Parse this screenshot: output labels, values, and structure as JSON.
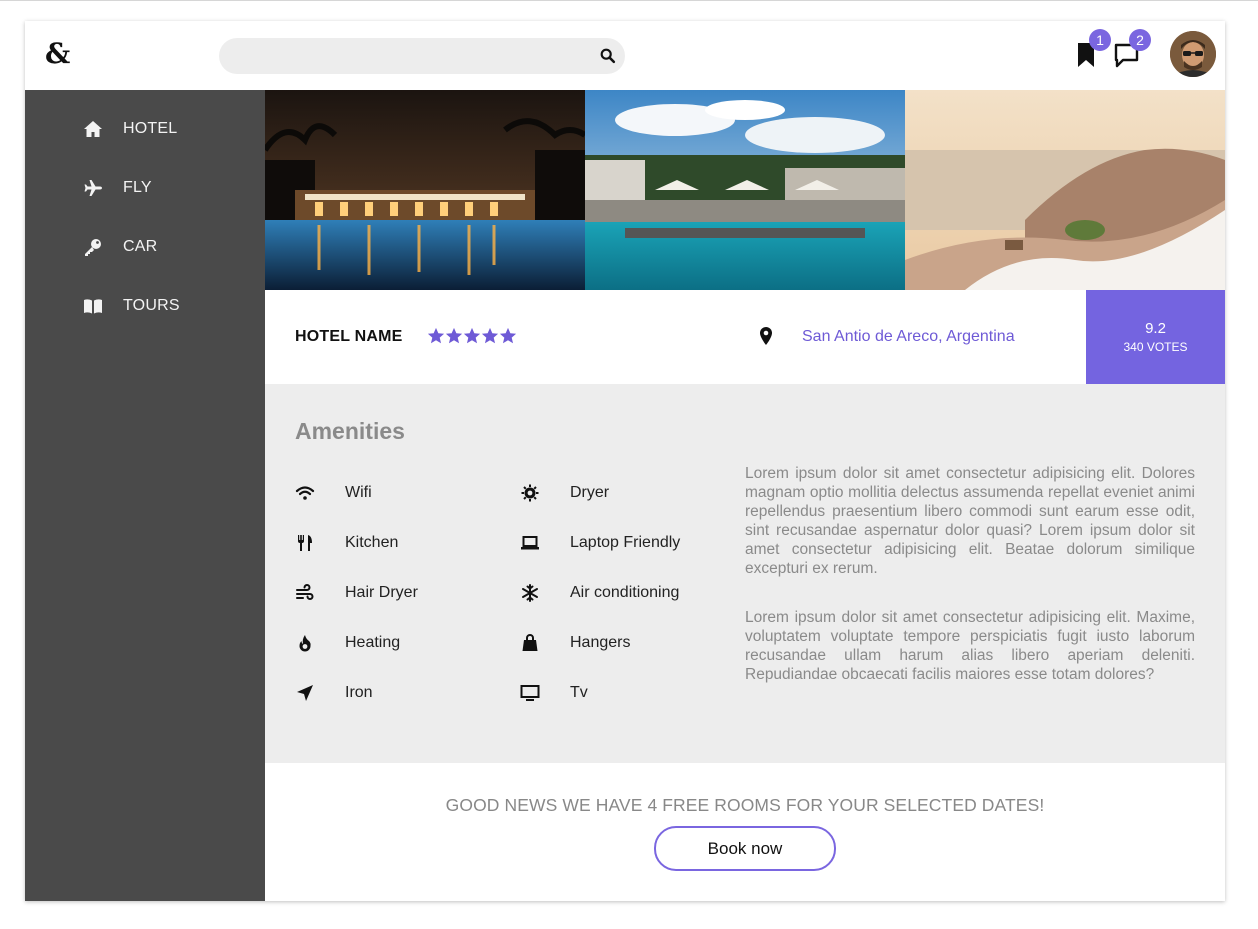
{
  "header": {
    "logo_text": "&",
    "search": {
      "placeholder": "",
      "value": ""
    },
    "bookmarks_count": "1",
    "messages_count": "2"
  },
  "sidebar": {
    "items": [
      {
        "label": "HOTEL",
        "icon": "home-icon"
      },
      {
        "label": "FLY",
        "icon": "plane-icon"
      },
      {
        "label": "CAR",
        "icon": "key-icon"
      },
      {
        "label": "TOURS",
        "icon": "book-icon"
      }
    ]
  },
  "hotel": {
    "name": "HOTEL NAME",
    "stars": 5,
    "location": "San Antio de Areco, Argentina",
    "score": "9.2",
    "votes": "340 VOTES"
  },
  "amenities": {
    "title": "Amenities",
    "items": [
      {
        "label": "Wifi",
        "icon": "wifi-icon"
      },
      {
        "label": "Dryer",
        "icon": "dryer-icon"
      },
      {
        "label": "Kitchen",
        "icon": "utensils-icon"
      },
      {
        "label": "Laptop Friendly",
        "icon": "laptop-icon"
      },
      {
        "label": "Hair Dryer",
        "icon": "wind-icon"
      },
      {
        "label": "Air conditioning",
        "icon": "snowflake-icon"
      },
      {
        "label": "Heating",
        "icon": "flame-icon"
      },
      {
        "label": "Hangers",
        "icon": "bag-icon"
      },
      {
        "label": "Iron",
        "icon": "location-arrow-icon"
      },
      {
        "label": "Tv",
        "icon": "tv-icon"
      }
    ],
    "paragraphs": [
      "Lorem ipsum dolor sit amet consectetur adipisicing elit. Dolores magnam optio mollitia delectus assumenda repellat eveniet animi repellendus praesentium libero commodi sunt earum esse odit, sint recusandae aspernatur dolor quasi? Lorem ipsum dolor sit amet consectetur adipisicing elit. Beatae dolorum similique excepturi ex rerum.",
      "Lorem ipsum dolor sit amet consectetur adipisicing elit. Maxime, voluptatem voluptate tempore perspiciatis fugit iusto laborum recusandae ullam harum alias libero aperiam deleniti. Repudiandae obcaecati facilis maiores esse totam dolores?"
    ]
  },
  "promo": {
    "text": "GOOD NEWS WE HAVE 4 FREE ROOMS FOR YOUR SELECTED DATES!",
    "button_label": "Book now"
  },
  "colors": {
    "accent": "#7464e0",
    "sidebar": "#4a4a4a",
    "amenities_bg": "#ededed"
  }
}
